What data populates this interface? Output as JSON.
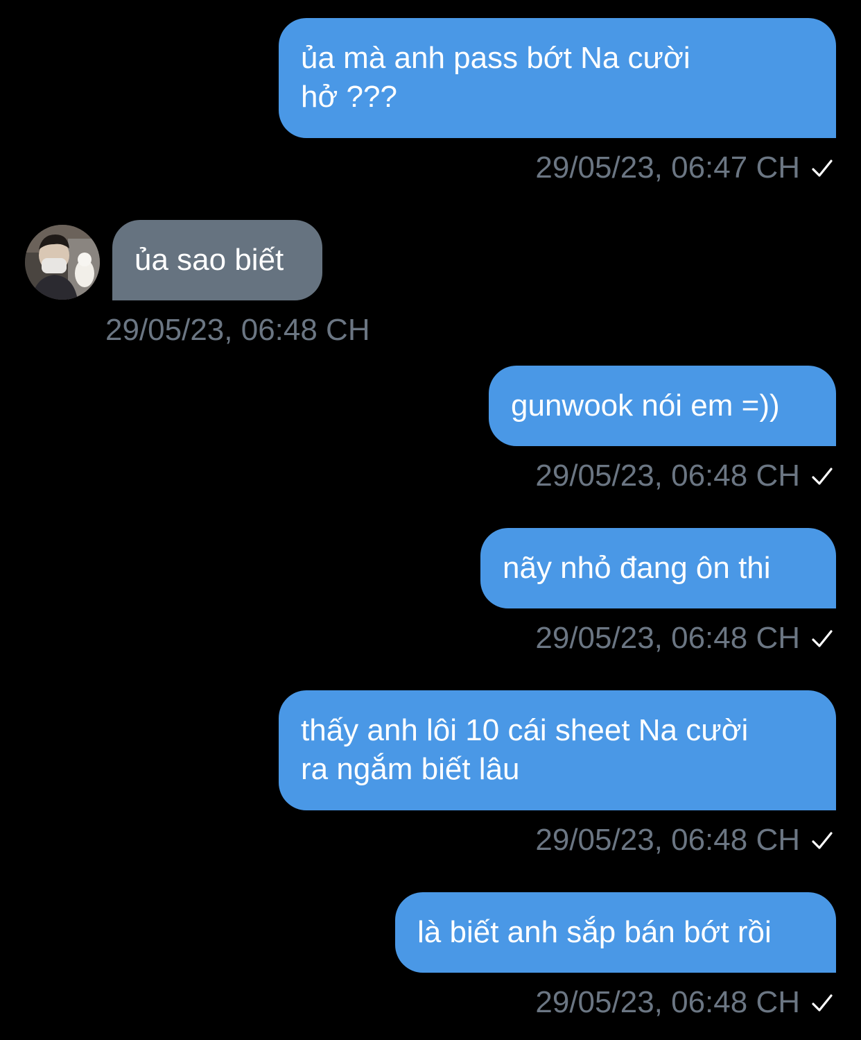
{
  "colors": {
    "background": "#000000",
    "outgoing_bubble": "#4a98e6",
    "incoming_bubble": "#667380",
    "timestamp": "#6b7683"
  },
  "messages": [
    {
      "direction": "outgoing",
      "text": "ủa mà anh pass bớt Na cười\nhở ???",
      "time": "29/05/23, 06:47 CH",
      "status_icon": "checkmark-icon"
    },
    {
      "direction": "incoming",
      "text": "ủa sao biết",
      "time": "29/05/23, 06:48 CH",
      "avatar_icon": "user-avatar"
    },
    {
      "direction": "outgoing",
      "text": "gunwook nói em =))",
      "time": "29/05/23, 06:48 CH",
      "status_icon": "checkmark-icon"
    },
    {
      "direction": "outgoing",
      "text": "nãy nhỏ đang ôn thi",
      "time": "29/05/23, 06:48 CH",
      "status_icon": "checkmark-icon"
    },
    {
      "direction": "outgoing",
      "text": "thấy anh lôi 10 cái sheet Na cười\nra ngắm biết lâu",
      "time": "29/05/23, 06:48 CH",
      "status_icon": "checkmark-icon"
    },
    {
      "direction": "outgoing",
      "text": "là biết anh sắp bán bớt rồi",
      "time": "29/05/23, 06:48 CH",
      "status_icon": "checkmark-icon"
    }
  ]
}
